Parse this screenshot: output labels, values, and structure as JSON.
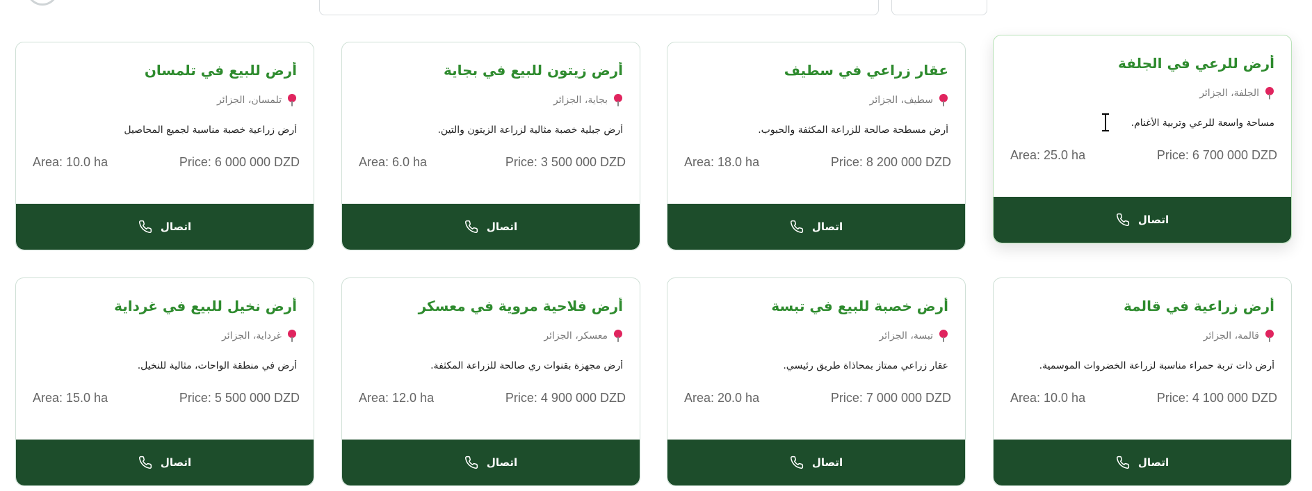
{
  "contact_label": "اتصال",
  "colors": {
    "title": "#2e8b2e",
    "button_bg": "#1d4d2b",
    "pin": "#e0245e"
  },
  "listings": [
    {
      "title": "أرض للبيع في تلمسان",
      "location": "تلمسان، الجزائر",
      "description": "أرض زراعية خصبة مناسبة لجميع المحاصيل",
      "area": "Area: 10.0 ha",
      "price": "Price: 6 000 000 DZD"
    },
    {
      "title": "أرض زيتون للبيع في بجاية",
      "location": "بجاية، الجزائر",
      "description": "أرض جبلية خصبة مثالية لزراعة الزيتون والتين.",
      "area": "Area: 6.0 ha",
      "price": "Price: 3 500 000 DZD"
    },
    {
      "title": "عقار زراعي في سطيف",
      "location": "سطيف، الجزائر",
      "description": "أرض مسطحة صالحة للزراعة المكثفة والحبوب.",
      "area": "Area: 18.0 ha",
      "price": "Price: 8 200 000 DZD"
    },
    {
      "title": "أرض للرعي في الجلفة",
      "location": "الجلفة، الجزائر",
      "description": "مساحة واسعة للرعي وتربية الأغنام.",
      "area": "Area: 25.0 ha",
      "price": "Price: 6 700 000 DZD"
    },
    {
      "title": "أرض نخيل للبيع في غرداية",
      "location": "غرداية، الجزائر",
      "description": "أرض في منطقة الواحات، مثالية للنخيل.",
      "area": "Area: 15.0 ha",
      "price": "Price: 5 500 000 DZD"
    },
    {
      "title": "أرض فلاحية مروية في معسكر",
      "location": "معسكر، الجزائر",
      "description": "أرض مجهزة بقنوات ري صالحة للزراعة المكثفة.",
      "area": "Area: 12.0 ha",
      "price": "Price: 4 900 000 DZD"
    },
    {
      "title": "أرض خصبة للبيع في تبسة",
      "location": "تبسة، الجزائر",
      "description": "عقار زراعي ممتاز بمحاذاة طريق رئيسي.",
      "area": "Area: 20.0 ha",
      "price": "Price: 7 000 000 DZD"
    },
    {
      "title": "أرض زراعية في قالمة",
      "location": "قالمة، الجزائر",
      "description": "أرض ذات تربة حمراء مناسبة لزراعة الخضروات الموسمية.",
      "area": "Area: 10.0 ha",
      "price": "Price: 4 100 000 DZD"
    }
  ]
}
